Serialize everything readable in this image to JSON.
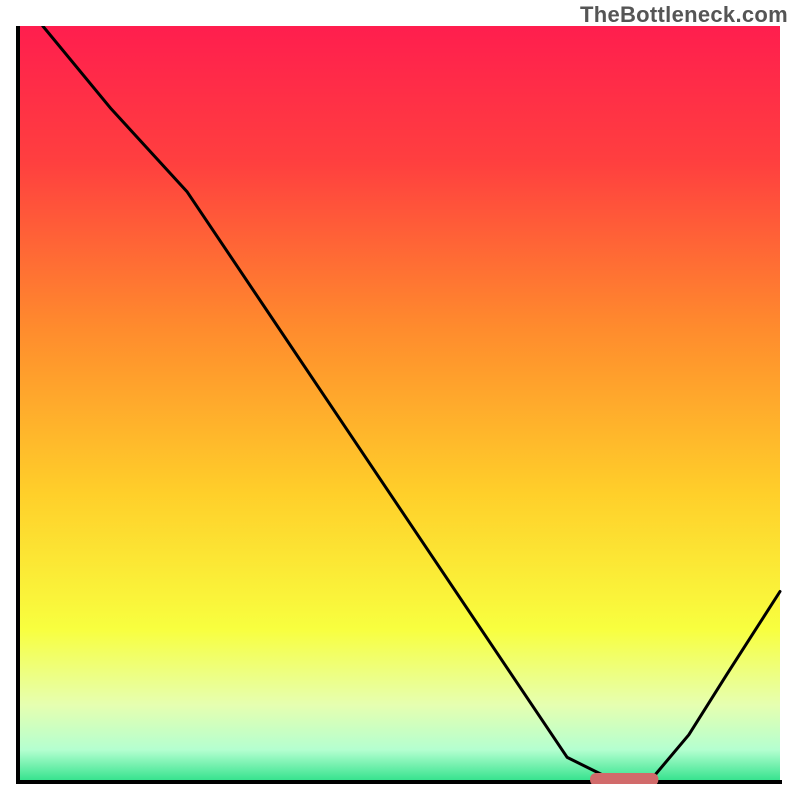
{
  "watermark": "TheBottleneck.com",
  "chart_data": {
    "type": "line",
    "title": "",
    "xlabel": "",
    "ylabel": "",
    "xlim": [
      0,
      100
    ],
    "ylim": [
      0,
      100
    ],
    "grid": false,
    "legend": false,
    "series": [
      {
        "name": "bottleneck-curve",
        "x": [
          3,
          12,
          22,
          32,
          42,
          52,
          62,
          72,
          78,
          83,
          88,
          93,
          100
        ],
        "values": [
          100,
          89,
          78,
          63,
          48,
          33,
          18,
          3,
          0,
          0,
          6,
          14,
          25
        ]
      }
    ],
    "marker": {
      "name": "optimal-range",
      "x_start": 75,
      "x_end": 84,
      "y": 0,
      "color": "#d16a6a"
    },
    "background_gradient": {
      "stops": [
        {
          "offset": 0.0,
          "color": "#ff1e4e"
        },
        {
          "offset": 0.18,
          "color": "#ff3f3f"
        },
        {
          "offset": 0.4,
          "color": "#ff8b2d"
        },
        {
          "offset": 0.62,
          "color": "#ffcf2a"
        },
        {
          "offset": 0.8,
          "color": "#f8ff3f"
        },
        {
          "offset": 0.9,
          "color": "#e6ffb0"
        },
        {
          "offset": 0.96,
          "color": "#b4ffd0"
        },
        {
          "offset": 1.0,
          "color": "#38e38f"
        }
      ]
    }
  }
}
